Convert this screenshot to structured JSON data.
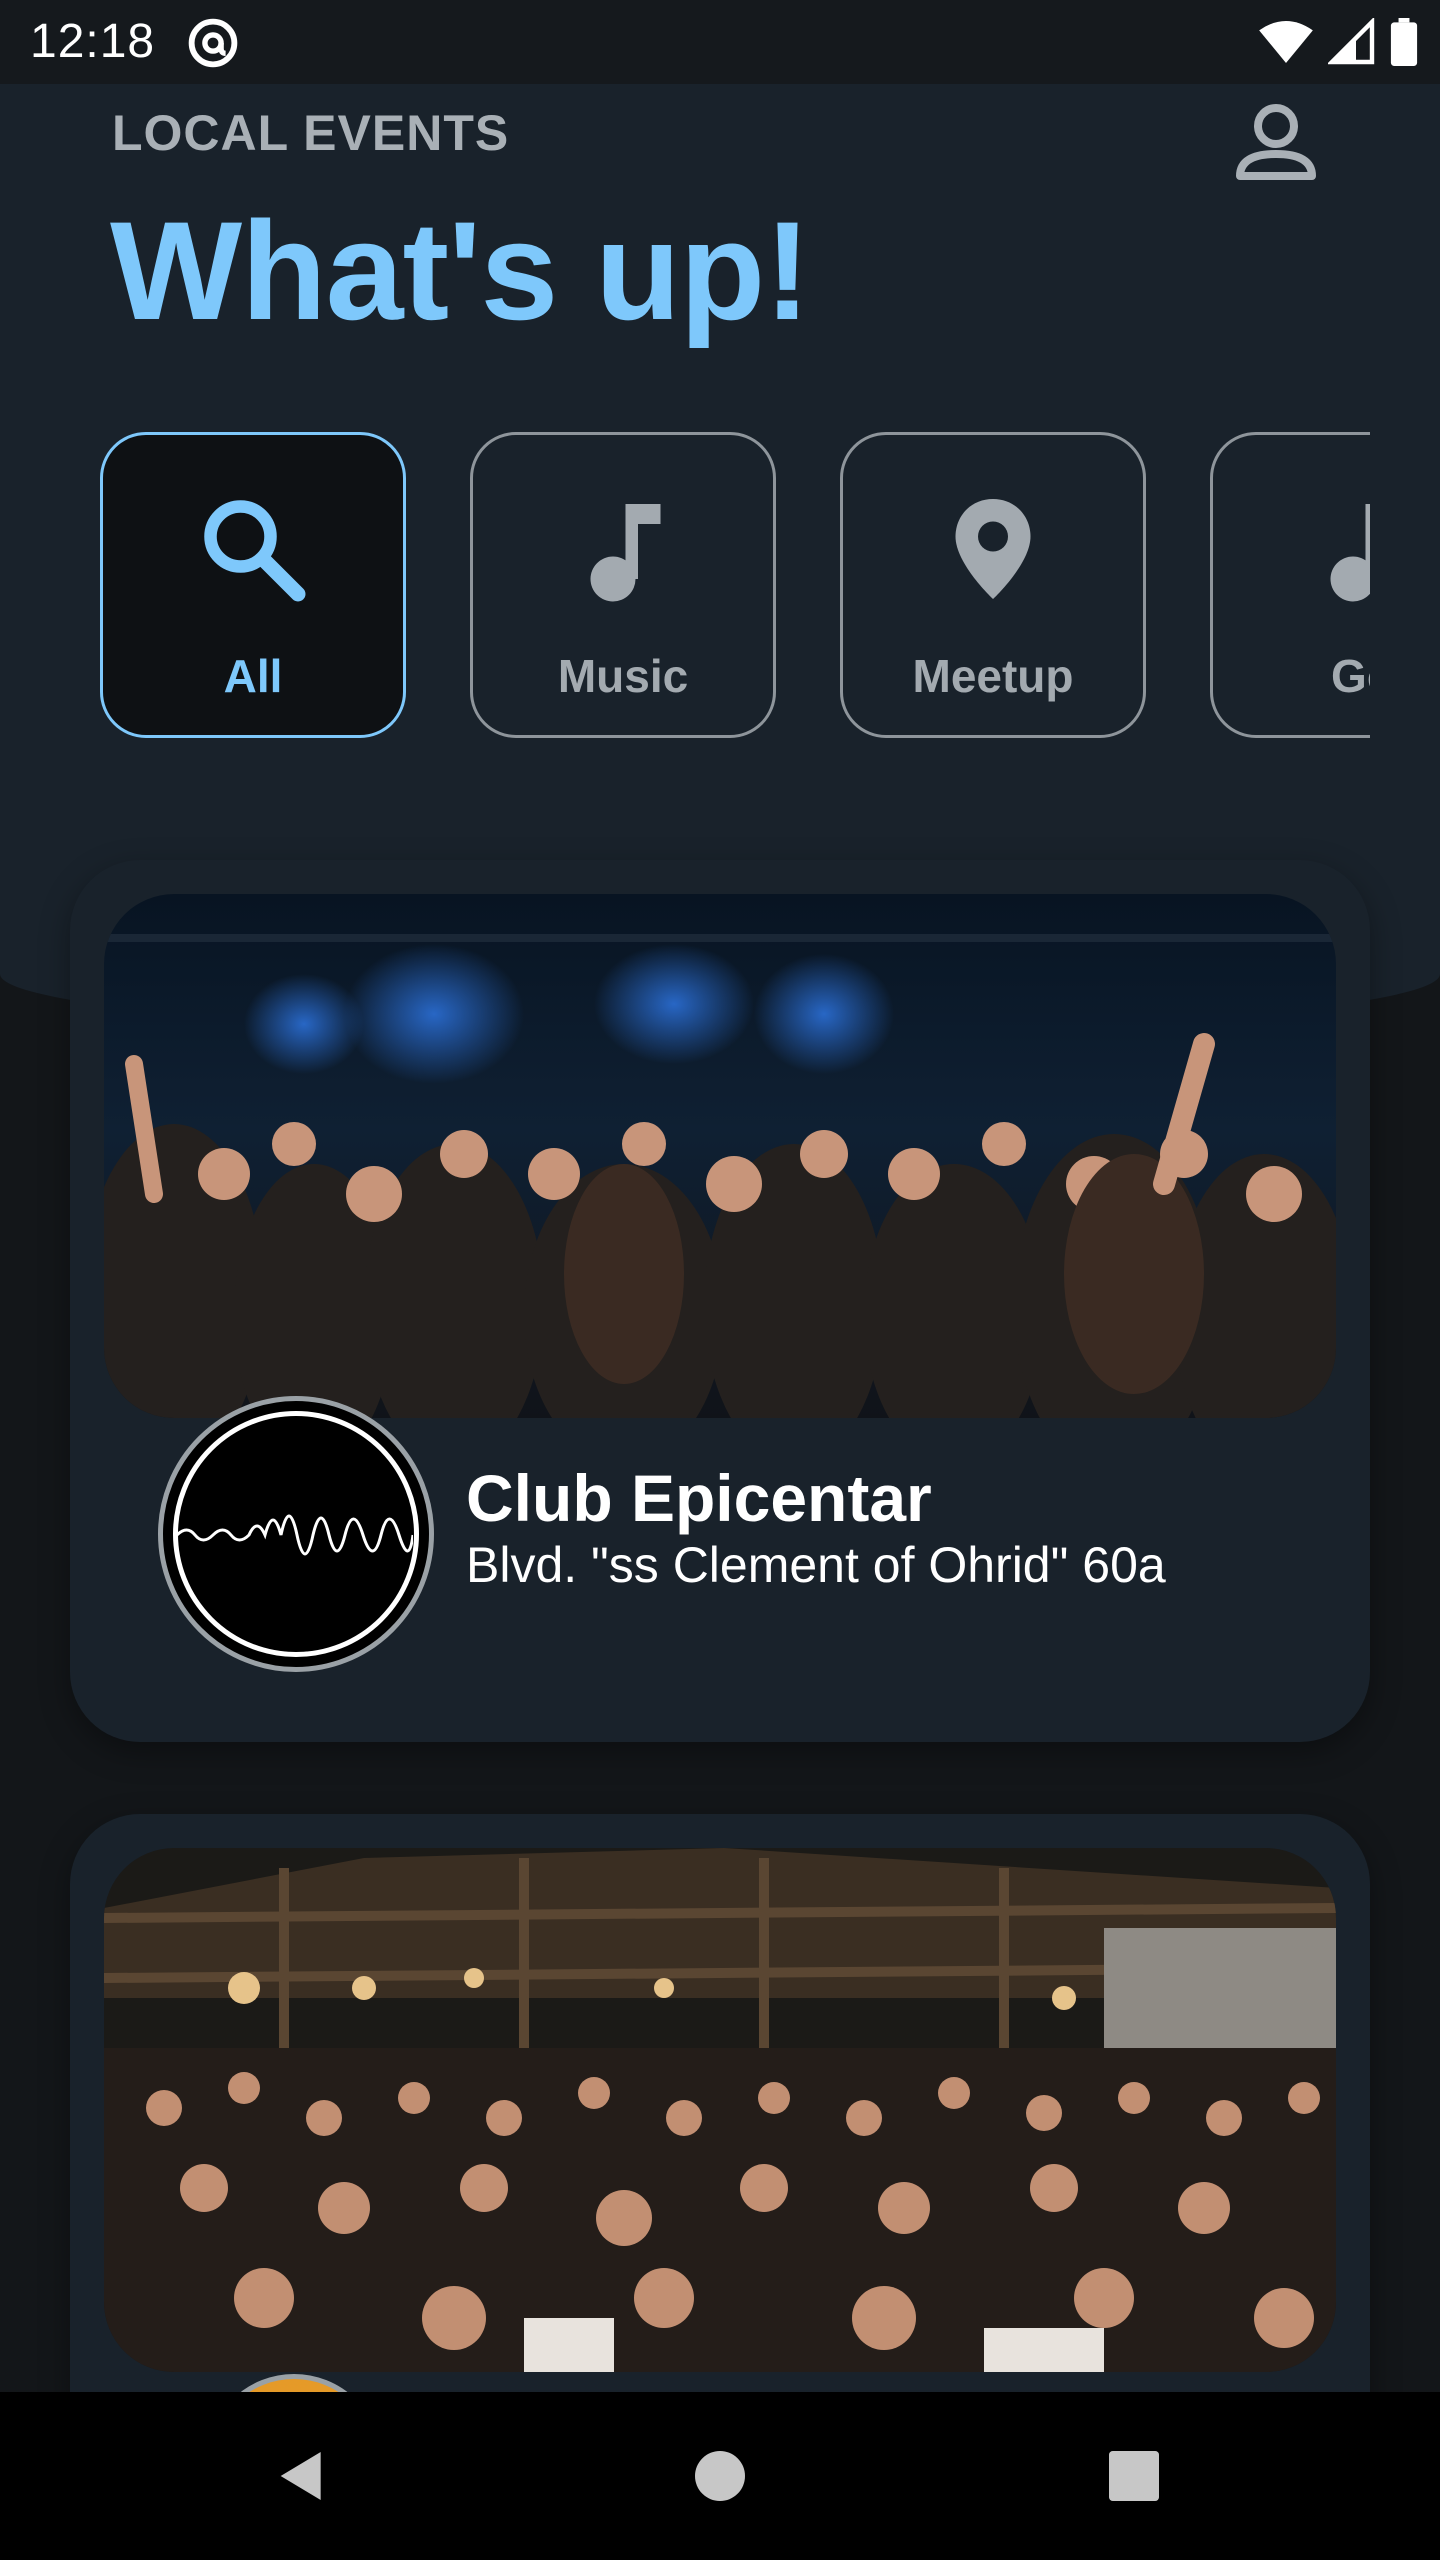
{
  "status_bar": {
    "time": "12:18",
    "icons": [
      "at-sign-icon",
      "wifi-icon",
      "signal-icon",
      "battery-icon"
    ]
  },
  "header": {
    "overline": "LOCAL EVENTS",
    "title": "What's up!",
    "profile_icon": "account-icon"
  },
  "categories": [
    {
      "label": "All",
      "icon": "search-icon",
      "selected": true
    },
    {
      "label": "Music",
      "icon": "music-note-icon",
      "selected": false
    },
    {
      "label": "Meetup",
      "icon": "location-pin-icon",
      "selected": false
    },
    {
      "label": "Go",
      "icon": "music-note-icon",
      "selected": false
    }
  ],
  "events": [
    {
      "name": "Club Epicentar",
      "address": "Blvd. \"ss Clement of Ohrid\" 60a"
    },
    {
      "name": "",
      "address": ""
    }
  ],
  "nav_bar": {
    "buttons": [
      "back-icon",
      "home-icon",
      "recents-icon"
    ]
  },
  "colors": {
    "accent": "#7ec8fb",
    "header_bg": "#19222b",
    "page_bg": "#131619",
    "chip_border": "#8e959b"
  }
}
